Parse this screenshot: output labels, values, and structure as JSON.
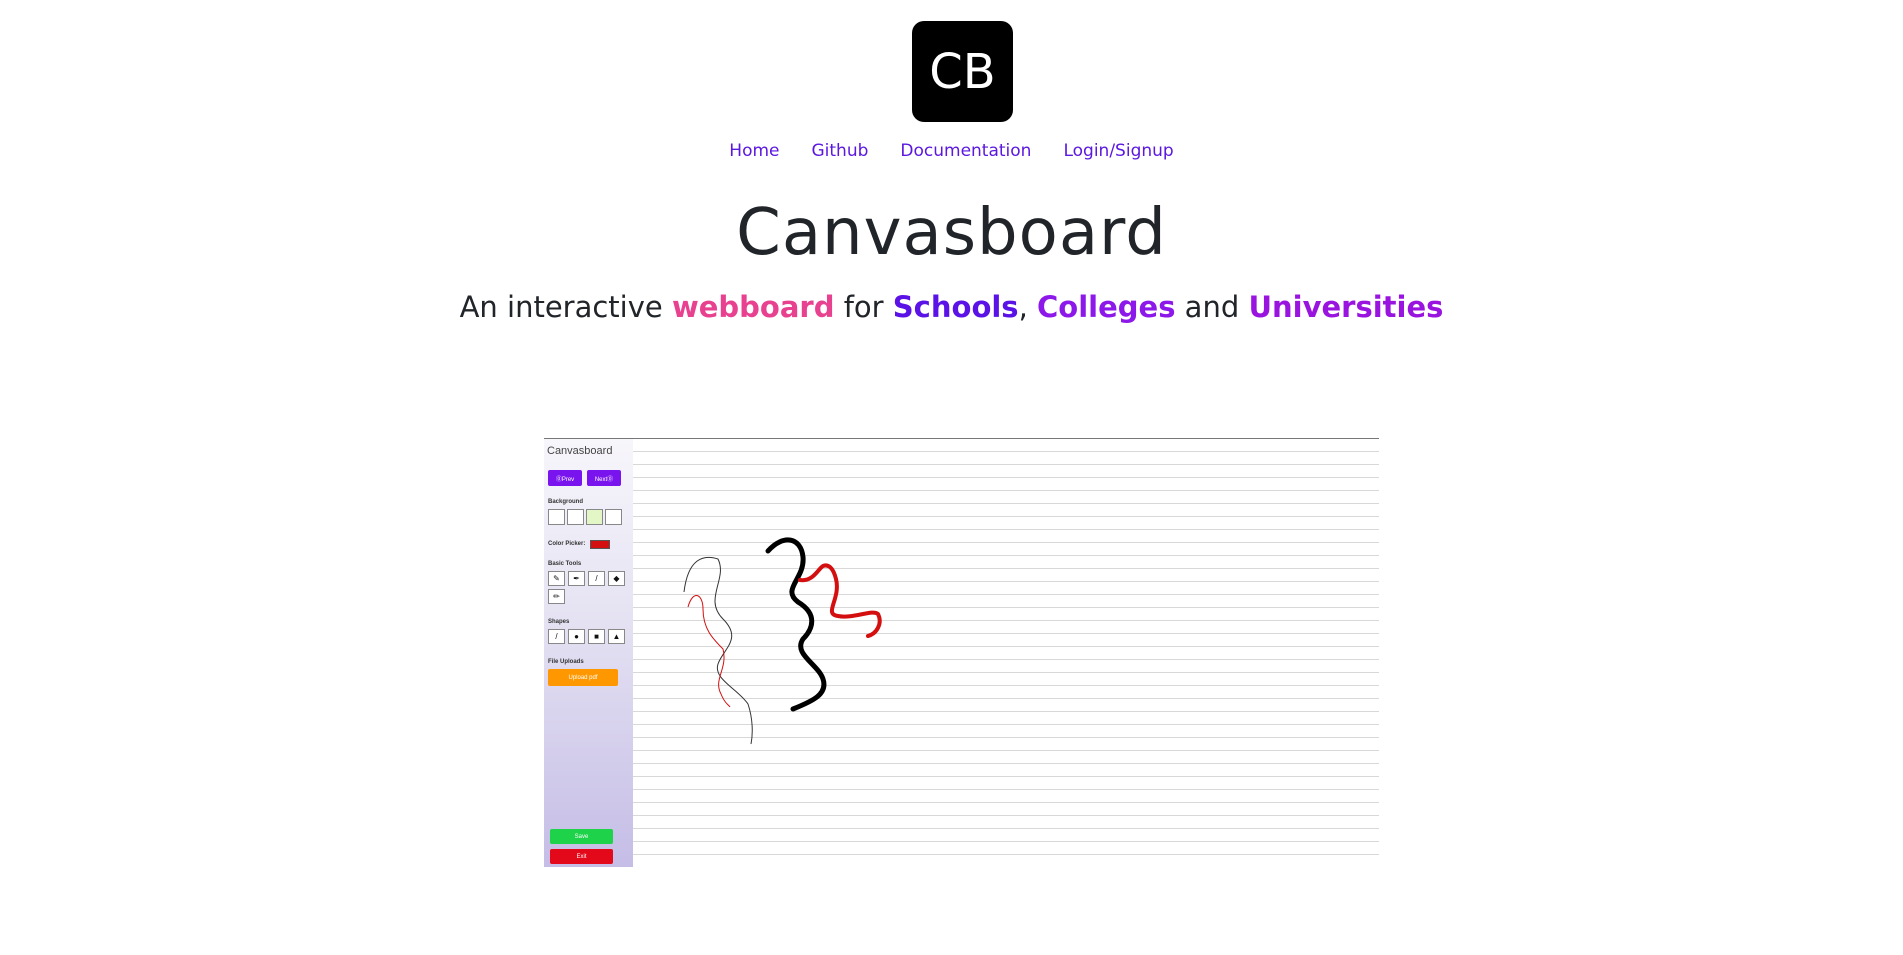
{
  "logo": {
    "text": "CB"
  },
  "nav": {
    "items": [
      "Home",
      "Github",
      "Documentation",
      "Login/Signup"
    ]
  },
  "hero": {
    "title": "Canvasboard",
    "subtitle": {
      "part1": "An interactive ",
      "webboard": "webboard",
      "part2": " for ",
      "schools": "Schools",
      "comma": ",",
      "colleges": "Colleges",
      "part3": " and ",
      "universities": "Universities"
    }
  },
  "screenshot": {
    "app_title": "Canvasboard",
    "prev_label": "⓪Prev",
    "next_label": "Next⓪",
    "background_label": "Background",
    "color_picker_label": "Color Picker:",
    "basic_tools_label": "Basic Tools",
    "shapes_label": "Shapes",
    "file_uploads_label": "File Uploads",
    "upload_label": "Upload pdf",
    "save_label": "Save",
    "exit_label": "Exit",
    "colors": {
      "pen": "#d40f0f",
      "ink": "#000000"
    }
  }
}
